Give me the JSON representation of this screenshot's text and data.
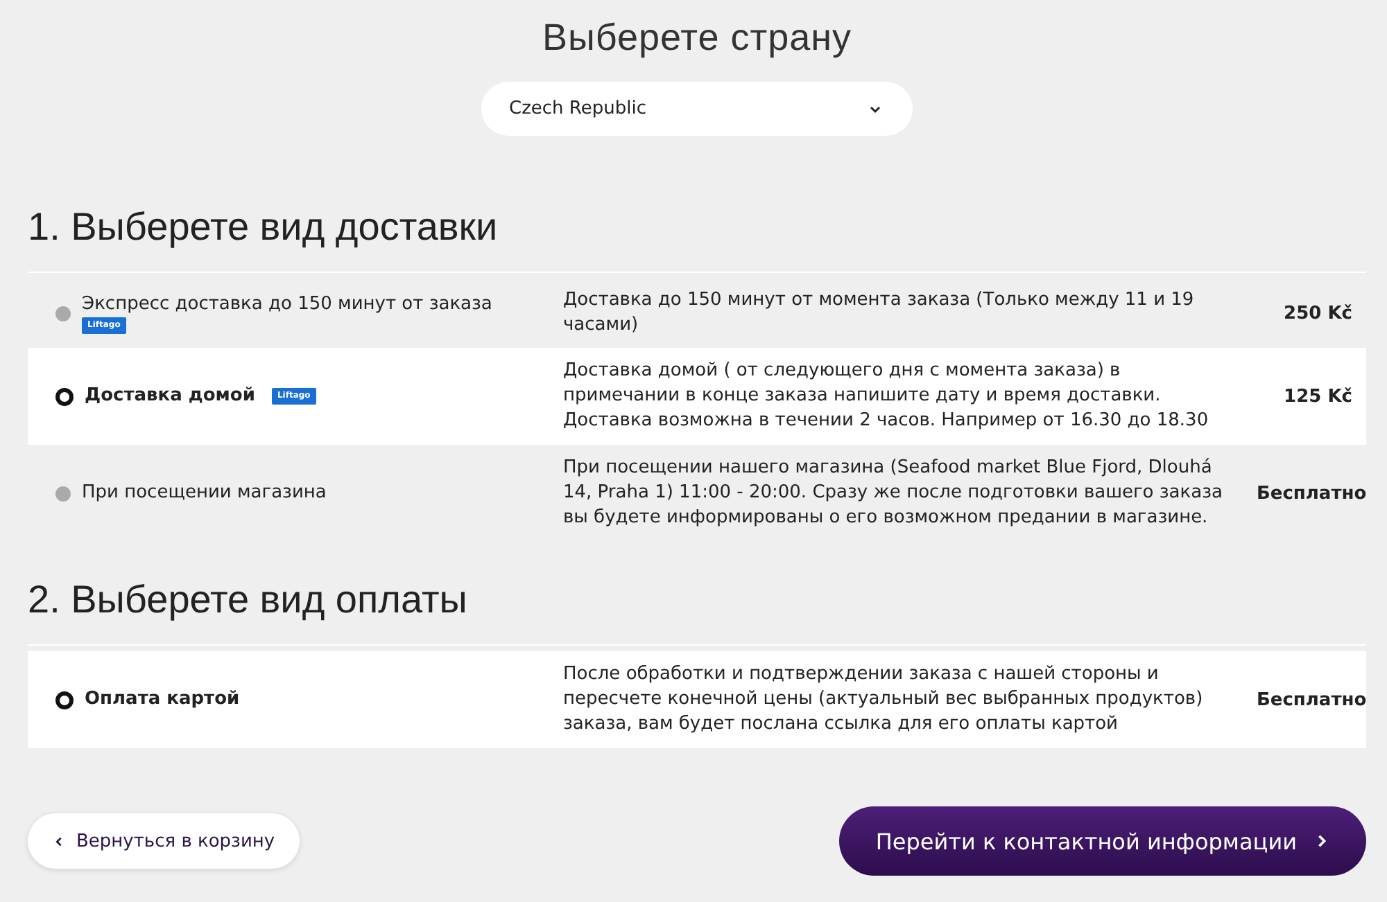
{
  "country": {
    "title": "Выберете страну",
    "value": "Czech Republic"
  },
  "sections": [
    {
      "heading": "1. Выберете вид доставки",
      "options": [
        {
          "label": "Экспресс доставка до 150 минут от заказа",
          "badge": "Liftago",
          "badge_wrap": true,
          "description": "Доставка до 150 минут от момента заказа (Только между 11 и 19 часами)",
          "price": "250 Kč",
          "selected": false
        },
        {
          "label": "Доставка домой",
          "badge": "Liftago",
          "badge_wrap": false,
          "description": "Доставка домой ( от следующего дня с момента заказа) в примечании в конце заказа напишите дату и время доставки. Доставка возможна в течении 2 часов. Например от 16.30 до 18.30",
          "price": "125 Kč",
          "selected": true
        },
        {
          "label": "При посещении магазина",
          "description": "При посещении нашего магазина (Seafood market Blue Fjord, Dlouhá 14, Praha 1) 11:00 - 20:00. Сразу же после подготовки вашего заказа вы будете информированы о его возможном предании в магазине.",
          "price": "Бесплатно",
          "selected": false
        }
      ]
    },
    {
      "heading": "2. Выберете вид оплаты",
      "options": [
        {
          "label": "Оплата картой",
          "description": "После обработки и подтверждении заказа с нашей стороны и пересчете конечной цены (актуальный вес выбранных продуктов) заказа, вам будет послана ссылка для его оплаты картой",
          "price": "Бесплатно",
          "selected": true
        }
      ]
    }
  ],
  "back_button": "Вернуться в корзину",
  "next_button": "Перейти к контактной информации"
}
